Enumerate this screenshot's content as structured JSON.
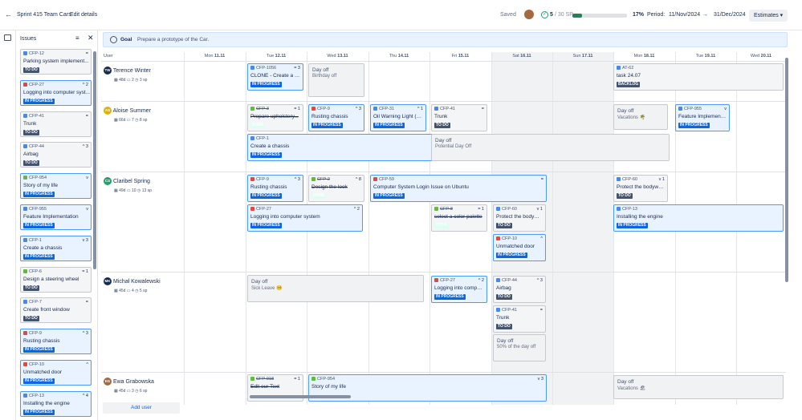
{
  "topbar": {
    "sprint": "Sprint 415 Team Cars",
    "edit": "Edit details",
    "saved": "Saved",
    "sp_done": "5",
    "sp_total": "/ 30 SP",
    "progress_pct": 17,
    "progress_label": "17%",
    "period_label": "Period:",
    "period_start": "11/Nov/2024",
    "period_end": "31/Dec/2024",
    "estimates": "Estimates"
  },
  "panel": {
    "title": "Issues",
    "items": [
      {
        "key": "CFP-12",
        "title": "Parking system implement...",
        "status": "TO DO",
        "type": "task",
        "color": "grey",
        "prio": "="
      },
      {
        "key": "CFP-27",
        "title": "Logging into computer syst...",
        "status": "IN PROGRESS",
        "type": "bug",
        "color": "blue",
        "prio": "^ 2"
      },
      {
        "key": "CFP-41",
        "title": "Trunk",
        "status": "TO DO",
        "type": "task",
        "color": "grey",
        "prio": "="
      },
      {
        "key": "CFP-44",
        "title": "Airbag",
        "status": "TO DO",
        "type": "task",
        "color": "grey",
        "prio": "^ 3"
      },
      {
        "key": "CFP-954",
        "title": "Story of my life",
        "status": "IN PROGRESS",
        "type": "story",
        "color": "blue",
        "prio": "v"
      },
      {
        "key": "CFP-955",
        "title": "Feature Implementation",
        "status": "IN PROGRESS",
        "type": "task",
        "color": "blue",
        "prio": "v"
      },
      {
        "key": "CFP-1",
        "title": "Create a chassis",
        "status": "IN PROGRESS",
        "type": "task",
        "color": "blue",
        "prio": "v 3"
      },
      {
        "key": "CFP-6",
        "title": "Design a steering wheel",
        "status": "TO DO",
        "type": "story",
        "color": "grey",
        "prio": "= 1"
      },
      {
        "key": "CFP-7",
        "title": "Create front window",
        "status": "TO DO",
        "type": "task",
        "color": "grey",
        "prio": "="
      },
      {
        "key": "CFP-9",
        "title": "Rusting chassis",
        "status": "IN PROGRESS",
        "type": "bug",
        "color": "blue",
        "prio": "^ 3"
      },
      {
        "key": "CFP-10",
        "title": "Unmatched door",
        "status": "IN PROGRESS",
        "type": "bug",
        "color": "blue",
        "prio": "^"
      },
      {
        "key": "CFP-13",
        "title": "Installing the engine",
        "status": "IN PROGRESS",
        "type": "task",
        "color": "blue",
        "prio": "^ 4"
      }
    ]
  },
  "goal": {
    "label": "Goal",
    "text": "Prepare a prototype of the Car."
  },
  "grid": {
    "user_header": "User",
    "days": [
      {
        "label": "Mon",
        "num": "11.11",
        "we": false
      },
      {
        "label": "Tue",
        "num": "12.11",
        "we": false
      },
      {
        "label": "Wed",
        "num": "13.11",
        "we": false
      },
      {
        "label": "Thu",
        "num": "14.11",
        "we": false
      },
      {
        "label": "Fri",
        "num": "15.11",
        "we": false
      },
      {
        "label": "Sat",
        "num": "16.11",
        "we": true
      },
      {
        "label": "Sun",
        "num": "17.11",
        "we": true
      },
      {
        "label": "Mon",
        "num": "18.11",
        "we": false
      },
      {
        "label": "Tue",
        "num": "19.11",
        "we": false
      },
      {
        "label": "Wed",
        "num": "20.11",
        "we": false
      }
    ]
  },
  "users": [
    {
      "name": "Terence Winter",
      "initials": "TW",
      "avatar_color": "#172b4d",
      "days": "48d",
      "issues": "2",
      "sp": "3 sp"
    },
    {
      "name": "Aloise Summer",
      "initials": "AS",
      "avatar_color": "#e2b203",
      "days": "66d",
      "issues": "7",
      "sp": "8 sp"
    },
    {
      "name": "Claribel Spring",
      "initials": "CS",
      "avatar_color": "#22a06b",
      "days": "49d",
      "issues": "10",
      "sp": "13 sp"
    },
    {
      "name": "Michał Kowalewski",
      "initials": "MK",
      "avatar_color": "#172b4d",
      "days": "45d",
      "issues": "4",
      "sp": "5 sp"
    },
    {
      "name": "Ewa Grabowska",
      "initials": "EG",
      "avatar_color": "#a5693f",
      "days": "45d",
      "issues": "3",
      "sp": "6 sp"
    }
  ],
  "cards": [
    {
      "key": "CFP-1056",
      "title": "CLONE - Create a c...",
      "status": "IN PROGRESS",
      "type": "task",
      "blue": true,
      "prio": "= 3",
      "strike": false
    },
    {
      "key": "AT-62",
      "title": "task 24.07",
      "status": "BACKLOG",
      "type": "task",
      "blue": false,
      "prio": "",
      "strike": false
    },
    {
      "key": "CFP-3",
      "title": "Prepare upholstery...",
      "status": "DONE",
      "type": "story",
      "blue": false,
      "prio": "= 1",
      "strike": true
    },
    {
      "key": "CFP-9",
      "title": "Rusting chassis",
      "status": "IN PROGRESS",
      "type": "bug",
      "blue": true,
      "prio": "^ 3",
      "strike": false
    },
    {
      "key": "CFP-31",
      "title": "Oil Warning Light (G...",
      "status": "IN PROGRESS",
      "type": "task",
      "blue": true,
      "prio": "^ 1",
      "strike": false
    },
    {
      "key": "CFP-41",
      "title": "Trunk",
      "status": "TO DO",
      "type": "task",
      "blue": false,
      "prio": "=",
      "strike": false
    },
    {
      "key": "CFP-955",
      "title": "Feature Implemento...",
      "status": "IN PROGRESS",
      "type": "task",
      "blue": true,
      "prio": "v",
      "strike": false
    },
    {
      "key": "CFP-1",
      "title": "Create a chassis",
      "status": "IN PROGRESS",
      "type": "task",
      "blue": true,
      "prio": "v 3",
      "strike": false
    },
    {
      "key": "CFP-9",
      "title": "Rusting chassis",
      "status": "IN PROGRESS",
      "type": "bug",
      "blue": true,
      "prio": "^ 3",
      "strike": false
    },
    {
      "key": "CFP-2",
      "title": "Design the look",
      "status": "DONE",
      "type": "story",
      "blue": false,
      "prio": "^ 8",
      "strike": true
    },
    {
      "key": "CFP-59",
      "title": "Computer System Login Issue on Ubuntu",
      "status": "IN PROGRESS",
      "type": "bug",
      "blue": true,
      "prio": "=",
      "strike": false
    },
    {
      "key": "CFP-60",
      "title": "Protect the bodywor...",
      "status": "TO DO",
      "type": "task",
      "blue": false,
      "prio": "v 1",
      "strike": false
    },
    {
      "key": "CFP-27",
      "title": "Logging into computer system",
      "status": "IN PROGRESS",
      "type": "bug",
      "blue": true,
      "prio": "^ 2",
      "strike": false
    },
    {
      "key": "CFP-8",
      "title": "select a color palette",
      "status": "DONE",
      "type": "story",
      "blue": false,
      "prio": "= 1",
      "strike": true
    },
    {
      "key": "CFP-60",
      "title": "Protect the bodywor...",
      "status": "TO DO",
      "type": "task",
      "blue": false,
      "prio": "v 1",
      "strike": false
    },
    {
      "key": "CFP-13",
      "title": "Installing the engine",
      "status": "IN PROGRESS",
      "type": "task",
      "blue": true,
      "prio": "",
      "strike": false
    },
    {
      "key": "CFP-10",
      "title": "Unmatched door",
      "status": "IN PROGRESS",
      "type": "bug",
      "blue": true,
      "prio": "^",
      "strike": false
    },
    {
      "key": "CFP-27",
      "title": "Logging into compu...",
      "status": "IN PROGRESS",
      "type": "bug",
      "blue": true,
      "prio": "^ 2",
      "strike": false
    },
    {
      "key": "CFP-44",
      "title": "Airbag",
      "status": "TO DO",
      "type": "task",
      "blue": false,
      "prio": "^ 3",
      "strike": false
    },
    {
      "key": "CFP-41",
      "title": "Trunk",
      "status": "TO DO",
      "type": "task",
      "blue": false,
      "prio": "=",
      "strike": false
    },
    {
      "key": "CFP-918",
      "title": "Edit our Text",
      "status": "",
      "type": "story",
      "blue": false,
      "prio": "= 1",
      "strike": true
    },
    {
      "key": "CFP-954",
      "title": "Story of my life",
      "status": "",
      "type": "story",
      "blue": true,
      "prio": "v 3",
      "strike": false
    }
  ],
  "dayoffs": [
    {
      "title": "Day off",
      "sub": "Birthday off"
    },
    {
      "title": "Day off",
      "sub": "Vacations 🌴"
    },
    {
      "title": "Day off",
      "sub": "Potential Day Off"
    },
    {
      "title": "Day off",
      "sub": "Sick Leave 🤒"
    },
    {
      "title": "Day off",
      "sub": "50% of the day off"
    },
    {
      "title": "Day off",
      "sub": "Vacations 🏖"
    }
  ],
  "add_user": "Add user",
  "colors": {
    "accent": "#0c66e4",
    "progress": "#1f845a",
    "weekend": "#f1f2f4"
  }
}
